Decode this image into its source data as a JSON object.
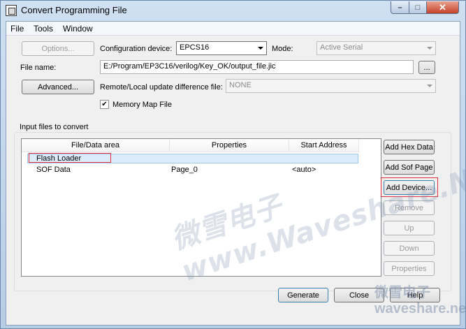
{
  "window": {
    "title": "Convert Programming File",
    "min_label": "–",
    "max_label": "□",
    "close_label": "✕"
  },
  "menubar": {
    "items": [
      "File",
      "Tools",
      "Window"
    ]
  },
  "options_button": "Options...",
  "config_device": {
    "label": "Configuration device:",
    "value": "EPCS16"
  },
  "mode": {
    "label": "Mode:",
    "value": "Active Serial"
  },
  "file_name": {
    "label": "File name:",
    "value": "E:/Program/EP3C16/verilog/Key_OK/output_file.jic",
    "browse_label": "..."
  },
  "advanced_button": "Advanced...",
  "remote_local": {
    "label": "Remote/Local update difference file:",
    "value": "NONE"
  },
  "memory_map": {
    "label": "Memory Map File",
    "checked": true,
    "check_glyph": "✔"
  },
  "input_files": {
    "group_label": "Input files to convert",
    "columns": [
      "File/Data area",
      "Properties",
      "Start Address"
    ],
    "rows": [
      {
        "name": "Flash Loader",
        "properties": "",
        "start": ""
      },
      {
        "name": "SOF Data",
        "properties": "Page_0",
        "start": "<auto>"
      }
    ]
  },
  "side_buttons": {
    "add_hex": "Add Hex Data",
    "add_sof": "Add Sof Page",
    "add_device": "Add Device...",
    "remove": "Remove",
    "up": "Up",
    "down": "Down",
    "properties": "Properties"
  },
  "bottom_buttons": {
    "generate": "Generate",
    "close": "Close",
    "help": "Help"
  },
  "watermark": {
    "main": "微雪电子 www.Waveshare.Net",
    "corner": "微雪电子 waveshare.net"
  },
  "colors": {
    "highlight": "#e0303c",
    "selection": "#dcecfc"
  }
}
